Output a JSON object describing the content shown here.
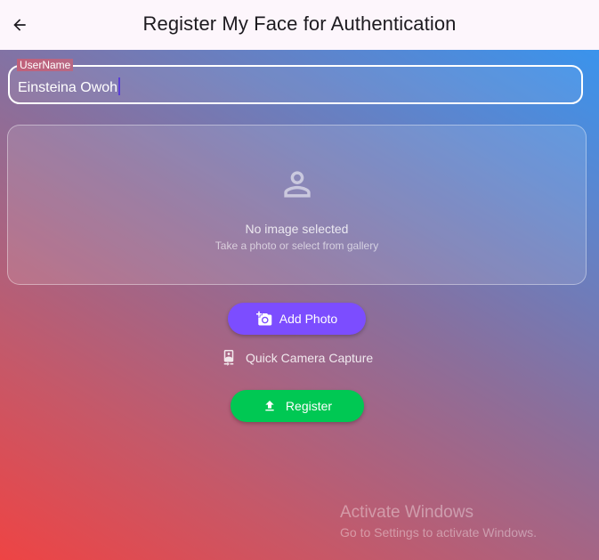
{
  "appbar": {
    "title": "Register My Face for Authentication",
    "back_icon": "arrow-left-icon"
  },
  "username_field": {
    "label": "UserName",
    "value": "Einsteina Owoh"
  },
  "image_preview": {
    "icon": "person-outline-icon",
    "empty_title": "No image selected",
    "empty_hint": "Take a photo or select from gallery"
  },
  "actions": {
    "add_photo_label": "Add Photo",
    "add_photo_icon": "add-a-photo-icon",
    "add_photo_color": "#7c4dff",
    "quick_capture_label": "Quick Camera Capture",
    "quick_capture_icon": "camera-front-icon",
    "register_label": "Register",
    "register_icon": "upload-icon",
    "register_color": "#00c853"
  },
  "watermark": {
    "title": "Activate Windows",
    "subtitle": "Go to Settings to activate Windows."
  },
  "theme": {
    "appbar_bg": "#fdf6fc",
    "gradient_start": "#ee4444",
    "gradient_end": "#2f98f6"
  }
}
